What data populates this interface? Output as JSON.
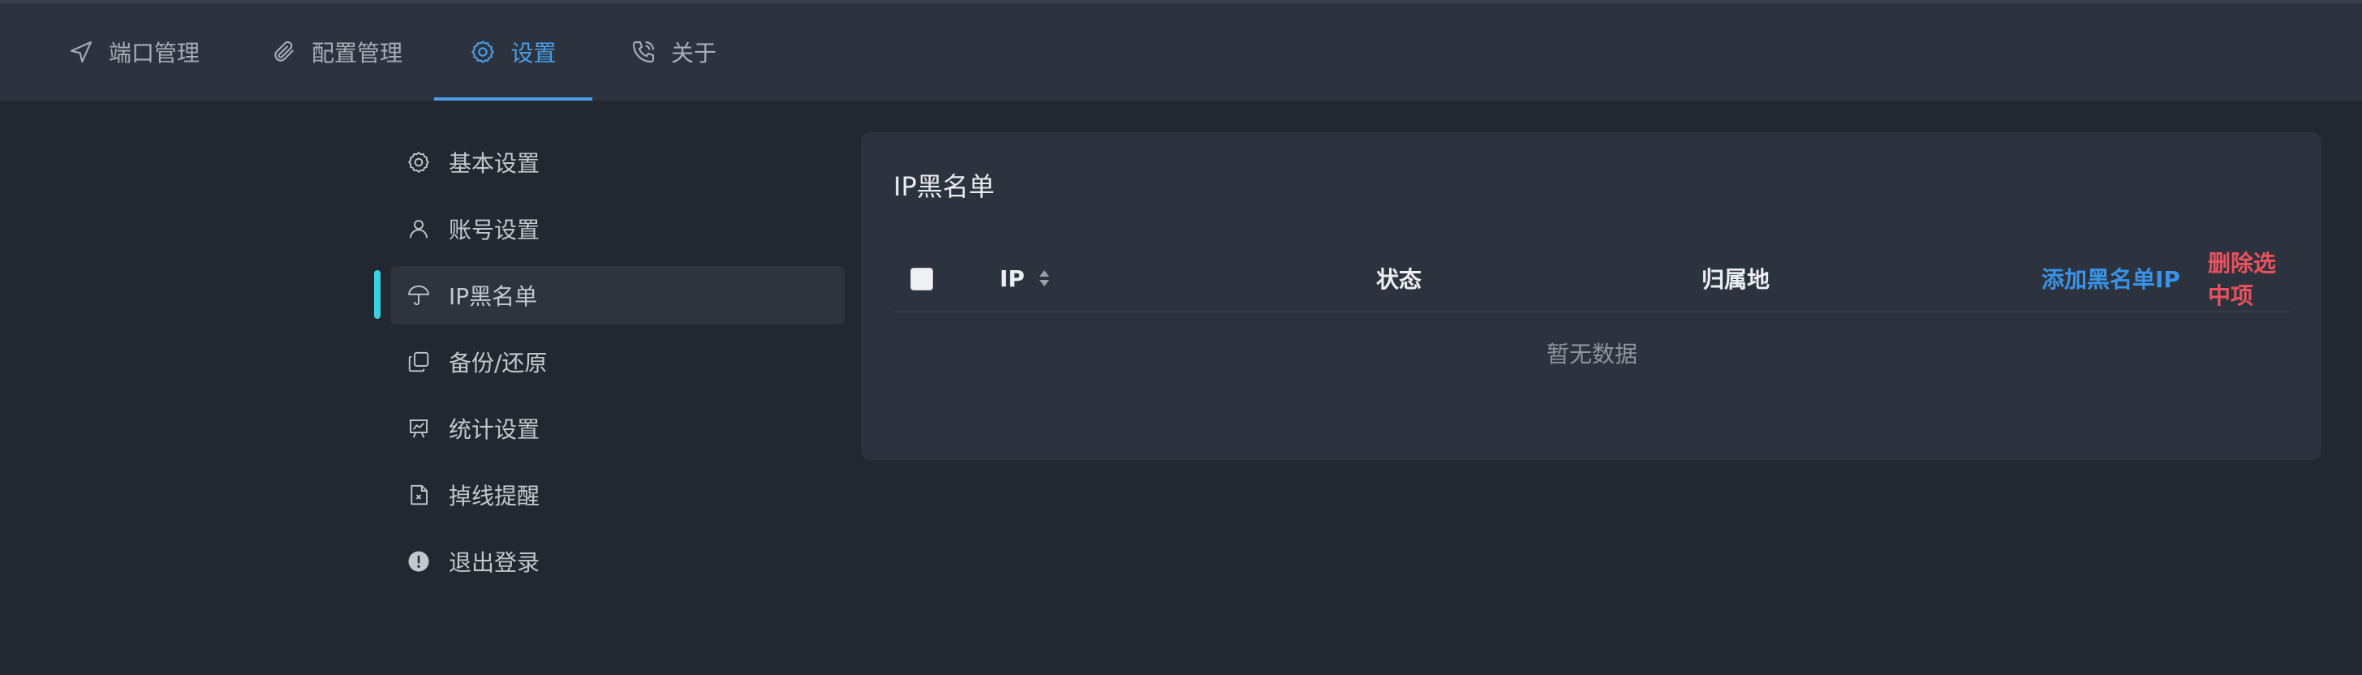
{
  "nav": {
    "tabs": [
      {
        "label": "端口管理",
        "icon": "send-icon"
      },
      {
        "label": "配置管理",
        "icon": "paperclip-icon"
      },
      {
        "label": "设置",
        "icon": "gear-icon",
        "active": true
      },
      {
        "label": "关于",
        "icon": "phone-icon"
      }
    ]
  },
  "sidebar": {
    "items": [
      {
        "label": "基本设置",
        "icon": "gear-icon"
      },
      {
        "label": "账号设置",
        "icon": "user-icon"
      },
      {
        "label": "IP黑名单",
        "icon": "umbrella-icon",
        "active": true
      },
      {
        "label": "备份/还原",
        "icon": "copy-icon"
      },
      {
        "label": "统计设置",
        "icon": "chart-board-icon"
      },
      {
        "label": "掉线提醒",
        "icon": "file-x-icon"
      },
      {
        "label": "退出登录",
        "icon": "alert-circle-icon"
      }
    ]
  },
  "blacklist": {
    "title": "IP黑名单",
    "columns": {
      "ip": "IP",
      "status": "状态",
      "location": "归属地"
    },
    "actions": {
      "add": "添加黑名单IP",
      "delete": "删除选中项"
    },
    "empty_text": "暂无数据"
  },
  "colors": {
    "background": "#232830",
    "panel": "#2d333e",
    "accent": "#4c9de6",
    "indicator": "#3bd0de",
    "danger": "#e9525e"
  }
}
